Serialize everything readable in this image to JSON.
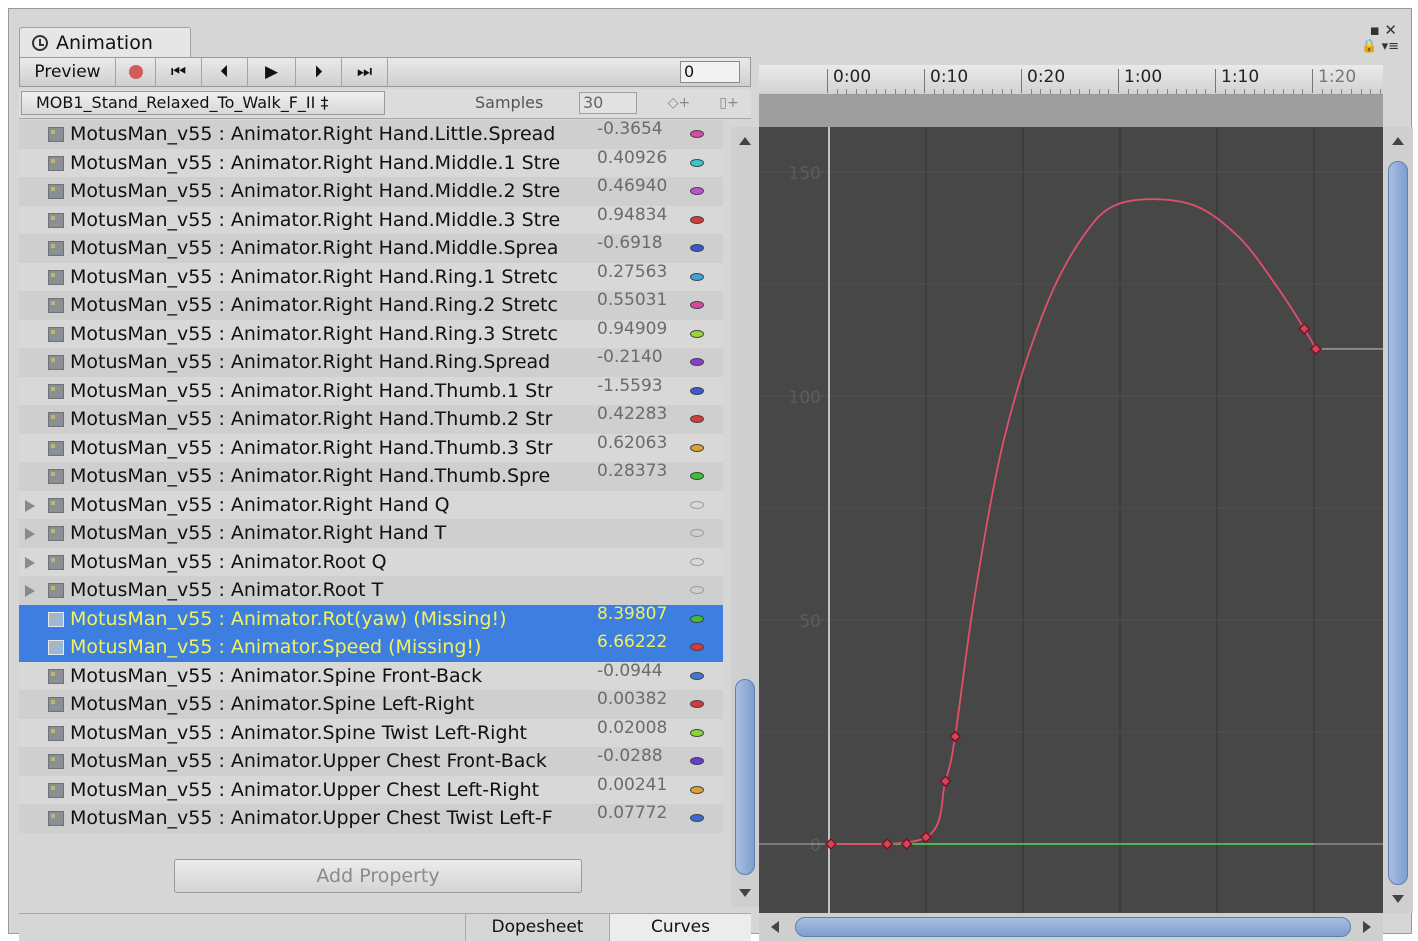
{
  "window": {
    "tab_title": "Animation",
    "controls": "▪ ✕",
    "controls2": "🔒 ▾≡"
  },
  "toolbar": {
    "preview_label": "Preview",
    "frame_value": "0"
  },
  "clip": {
    "selected": "MOB1_Stand_Relaxed_To_Walk_F_II ‡",
    "samples_label": "Samples",
    "samples_value": "30"
  },
  "properties": [
    {
      "label": "MotusMan_v55 : Animator.Right Hand.Little.Spread",
      "value": "-0.3654",
      "color": "#d94aa8",
      "expandable": false,
      "selected": false
    },
    {
      "label": "MotusMan_v55 : Animator.Right Hand.Middle.1 Stre",
      "value": "0.40926",
      "color": "#3cc7c7",
      "expandable": false,
      "selected": false
    },
    {
      "label": "MotusMan_v55 : Animator.Right Hand.Middle.2 Stre",
      "value": "0.46940",
      "color": "#c04fd6",
      "expandable": false,
      "selected": false
    },
    {
      "label": "MotusMan_v55 : Animator.Right Hand.Middle.3 Stre",
      "value": "0.94834",
      "color": "#d63a3a",
      "expandable": false,
      "selected": false
    },
    {
      "label": "MotusMan_v55 : Animator.Right Hand.Middle.Sprea",
      "value": "-0.6918",
      "color": "#3a56d6",
      "expandable": false,
      "selected": false
    },
    {
      "label": "MotusMan_v55 : Animator.Right Hand.Ring.1 Stretc",
      "value": "0.27563",
      "color": "#3aa8d6",
      "expandable": false,
      "selected": false
    },
    {
      "label": "MotusMan_v55 : Animator.Right Hand.Ring.2 Stretc",
      "value": "0.55031",
      "color": "#d64aa0",
      "expandable": false,
      "selected": false
    },
    {
      "label": "MotusMan_v55 : Animator.Right Hand.Ring.3 Stretc",
      "value": "0.94909",
      "color": "#9ad63a",
      "expandable": false,
      "selected": false
    },
    {
      "label": "MotusMan_v55 : Animator.Right Hand.Ring.Spread",
      "value": "-0.2140",
      "color": "#8a3ad6",
      "expandable": false,
      "selected": false
    },
    {
      "label": "MotusMan_v55 : Animator.Right Hand.Thumb.1 Str",
      "value": "-1.5593",
      "color": "#3a5ad6",
      "expandable": false,
      "selected": false
    },
    {
      "label": "MotusMan_v55 : Animator.Right Hand.Thumb.2 Str",
      "value": "0.42283",
      "color": "#d63a3a",
      "expandable": false,
      "selected": false
    },
    {
      "label": "MotusMan_v55 : Animator.Right Hand.Thumb.3 Str",
      "value": "0.62063",
      "color": "#e0a030",
      "expandable": false,
      "selected": false
    },
    {
      "label": "MotusMan_v55 : Animator.Right Hand.Thumb.Spre",
      "value": "0.28373",
      "color": "#3ac03a",
      "expandable": false,
      "selected": false
    },
    {
      "label": "MotusMan_v55 : Animator.Right Hand Q",
      "value": "",
      "color": "",
      "expandable": true,
      "selected": false
    },
    {
      "label": "MotusMan_v55 : Animator.Right Hand T",
      "value": "",
      "color": "",
      "expandable": true,
      "selected": false
    },
    {
      "label": "MotusMan_v55 : Animator.Root Q",
      "value": "",
      "color": "",
      "expandable": true,
      "selected": false
    },
    {
      "label": "MotusMan_v55 : Animator.Root T",
      "value": "",
      "color": "",
      "expandable": true,
      "selected": false
    },
    {
      "label": "MotusMan_v55 : Animator.Rot(yaw) (Missing!)",
      "value": "8.39807",
      "color": "#3ac03a",
      "expandable": false,
      "selected": true
    },
    {
      "label": "MotusMan_v55 : Animator.Speed (Missing!)",
      "value": "6.66222",
      "color": "#d63a3a",
      "expandable": false,
      "selected": true
    },
    {
      "label": "MotusMan_v55 : Animator.Spine Front-Back",
      "value": "-0.0944",
      "color": "#3a7ad6",
      "expandable": false,
      "selected": false
    },
    {
      "label": "MotusMan_v55 : Animator.Spine Left-Right",
      "value": "0.00382",
      "color": "#d63a3a",
      "expandable": false,
      "selected": false
    },
    {
      "label": "MotusMan_v55 : Animator.Spine Twist Left-Right",
      "value": "0.02008",
      "color": "#8ad63a",
      "expandable": false,
      "selected": false
    },
    {
      "label": "MotusMan_v55 : Animator.Upper Chest Front-Back",
      "value": "-0.0288",
      "color": "#6a3ad6",
      "expandable": false,
      "selected": false
    },
    {
      "label": "MotusMan_v55 : Animator.Upper Chest Left-Right",
      "value": "0.00241",
      "color": "#e0a030",
      "expandable": false,
      "selected": false
    },
    {
      "label": "MotusMan_v55 : Animator.Upper Chest Twist Left-F",
      "value": "0.07772",
      "color": "#3a6ad6",
      "expandable": false,
      "selected": false
    }
  ],
  "add_property_label": "Add Property",
  "bottom_tabs": [
    "Dopesheet",
    "Curves"
  ],
  "active_bottom_tab": "Curves",
  "timeline": {
    "labels": [
      {
        "text": "0:00",
        "frame": 0
      },
      {
        "text": "0:10",
        "frame": 10
      },
      {
        "text": "0:20",
        "frame": 20
      },
      {
        "text": "1:00",
        "frame": 30
      },
      {
        "text": "1:10",
        "frame": 40
      },
      {
        "text": "1:20",
        "frame": 50
      }
    ]
  },
  "chart_data": {
    "type": "line",
    "xlabel": "",
    "ylabel": "",
    "y_ticks": [
      0,
      50,
      100,
      150
    ],
    "grid": true,
    "series": [
      {
        "color": "#e0506a",
        "keys": [
          [
            0.2,
            0
          ],
          [
            6,
            0
          ],
          [
            8,
            0
          ],
          [
            10,
            1.5
          ],
          [
            12,
            14
          ],
          [
            13,
            24
          ],
          [
            49,
            115
          ],
          [
            50.2,
            110.5
          ]
        ],
        "curve": [
          [
            0.2,
            0
          ],
          [
            10,
            1.5
          ],
          [
            12,
            14
          ],
          [
            13,
            24
          ],
          [
            15,
            55
          ],
          [
            18,
            90
          ],
          [
            22,
            118
          ],
          [
            26,
            135
          ],
          [
            30,
            143
          ],
          [
            37,
            143
          ],
          [
            42,
            136
          ],
          [
            46,
            125
          ],
          [
            49,
            115
          ],
          [
            50.2,
            110.5
          ]
        ],
        "hold_after": 110.5
      },
      {
        "color": "#4ec04e",
        "keys": [
          [
            0.2,
            0
          ]
        ],
        "curve": [
          [
            0.2,
            0
          ],
          [
            50,
            0
          ]
        ],
        "hold_after": null
      }
    ]
  }
}
